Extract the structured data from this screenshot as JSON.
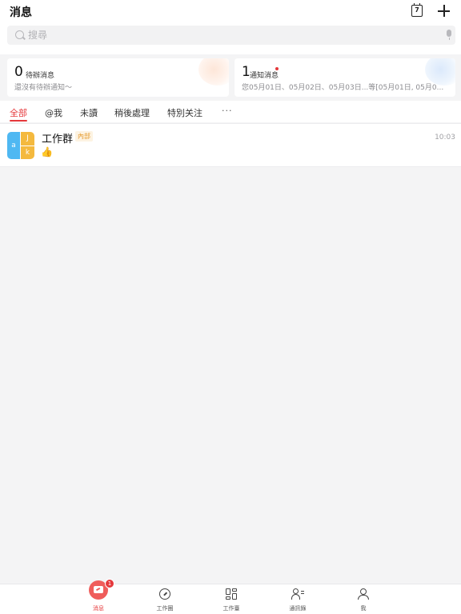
{
  "header": {
    "title": "消息",
    "calendar_day": "7",
    "search_placeholder": "搜尋"
  },
  "cards": {
    "pending": {
      "count": "0",
      "label": "待辦消息",
      "subtitle": "還沒有待辦通知～"
    },
    "notifications": {
      "count": "1",
      "label": "通知消息",
      "subtitle": "您05月01日、05月02日、05月03日...等[05月01日, 05月0..."
    }
  },
  "tabs": [
    {
      "label": "全部",
      "active": true
    },
    {
      "label": "@我",
      "active": false
    },
    {
      "label": "未讀",
      "active": false
    },
    {
      "label": "稍後處理",
      "active": false
    },
    {
      "label": "特別关注",
      "active": false
    }
  ],
  "more_label": "···",
  "conversations": [
    {
      "name": "工作群",
      "tag": "內部",
      "time": "10:03",
      "preview_icon": "thumbs-up-emoji",
      "avatar_letters": [
        "a",
        "J",
        "k"
      ]
    }
  ],
  "bottom_nav": {
    "items": [
      {
        "label": "消息",
        "icon": "message-icon",
        "active": true,
        "badge": "1"
      },
      {
        "label": "工作圈",
        "icon": "compass-icon",
        "active": false
      },
      {
        "label": "工作臺",
        "icon": "dashboard-icon",
        "active": false
      },
      {
        "label": "通訊錄",
        "icon": "contacts-icon",
        "active": false
      },
      {
        "label": "我",
        "icon": "profile-icon",
        "active": false
      }
    ]
  },
  "colors": {
    "accent": "#e5383b",
    "avatar_blue": "#4fb8f2",
    "avatar_yellow": "#f4b93e",
    "tag_text": "#e59b2e"
  }
}
